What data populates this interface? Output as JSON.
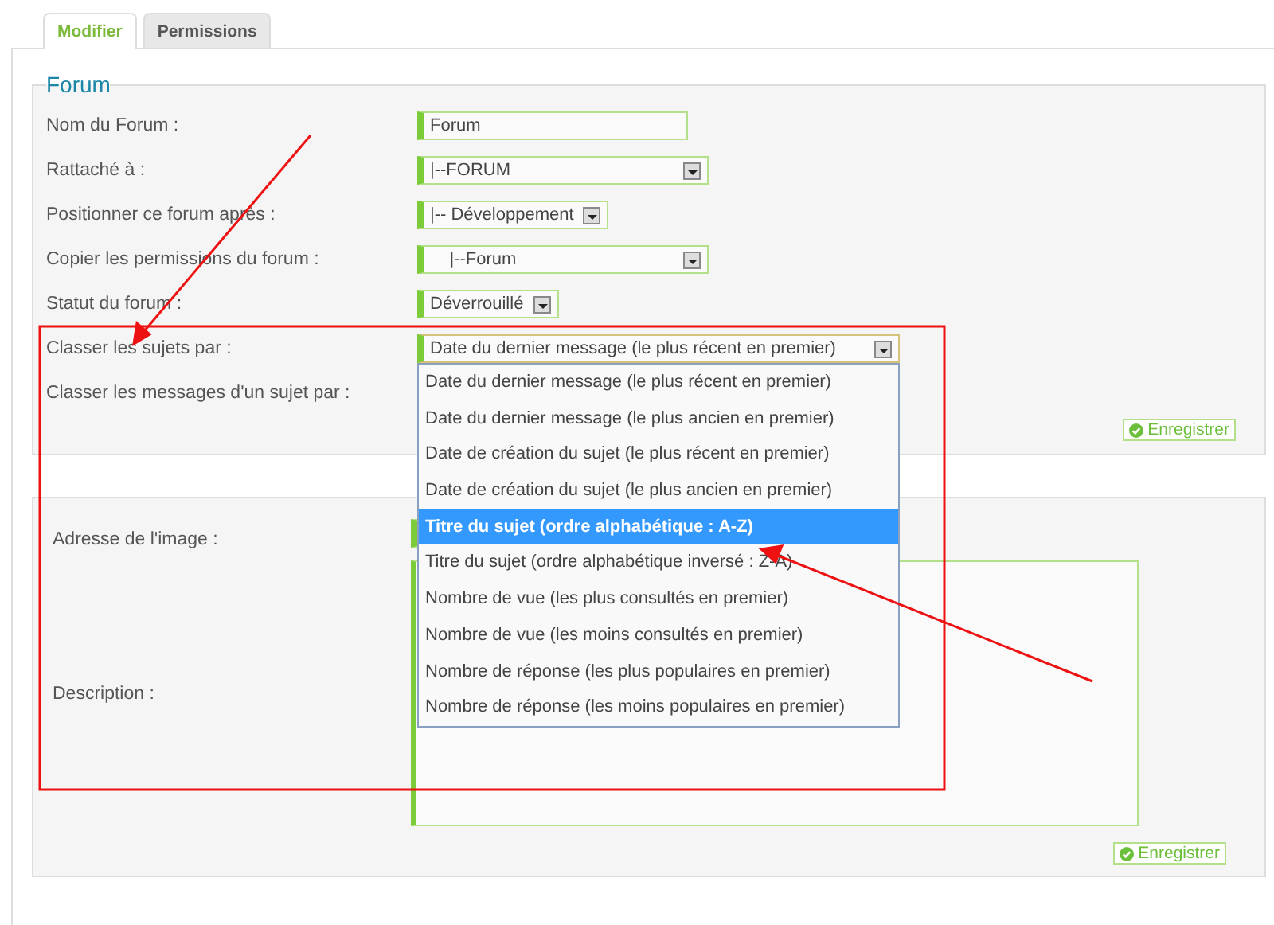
{
  "tabs": [
    {
      "label": "Modifier",
      "selected": true
    },
    {
      "label": "Permissions",
      "selected": false
    }
  ],
  "forum_section": {
    "title": "Forum",
    "fields": [
      {
        "label": "Nom du Forum :",
        "kind": "text",
        "value": "Forum"
      },
      {
        "label": "Rattaché à :",
        "kind": "select",
        "value": "|--FORUM"
      },
      {
        "label": "Positionner ce forum après :",
        "kind": "select",
        "value": "|-- Développement"
      },
      {
        "label": "Copier les permissions du forum :",
        "kind": "select",
        "value": "    |--Forum"
      },
      {
        "label": "Statut du forum :",
        "kind": "select",
        "value": "Déverrouillé"
      },
      {
        "label": "Classer les sujets par :",
        "kind": "select",
        "value": "Date du dernier message (le plus récent en premier)",
        "expanded": true,
        "options": [
          {
            "label": "Date du dernier message (le plus récent en premier)",
            "highlighted": false
          },
          {
            "label": "Date du dernier message (le plus ancien en premier)",
            "highlighted": false
          },
          {
            "label": "Date de création du sujet (le plus récent en premier)",
            "highlighted": false
          },
          {
            "label": "Date de création du sujet (le plus ancien en premier)",
            "highlighted": false
          },
          {
            "label": "Titre du sujet (ordre alphabétique : A-Z)",
            "highlighted": true
          },
          {
            "label": "Titre du sujet (ordre alphabétique inversé : Z-A)",
            "highlighted": false
          },
          {
            "label": "Nombre de vue (les plus consultés en premier)",
            "highlighted": false
          },
          {
            "label": "Nombre de vue (les moins consultés en premier)",
            "highlighted": false
          },
          {
            "label": "Nombre de réponse (les plus populaires en premier)",
            "highlighted": false
          },
          {
            "label": "Nombre de réponse (les moins populaires en premier)",
            "highlighted": false
          }
        ]
      },
      {
        "label": "Classer les messages d'un sujet par :"
      }
    ],
    "save_button": "Enregistrer"
  },
  "image_section": {
    "fields": [
      {
        "label": "Adresse de l'image :",
        "kind": "text"
      },
      {
        "label": "Description :",
        "kind": "textarea"
      }
    ],
    "save_button": "Enregistrer"
  }
}
